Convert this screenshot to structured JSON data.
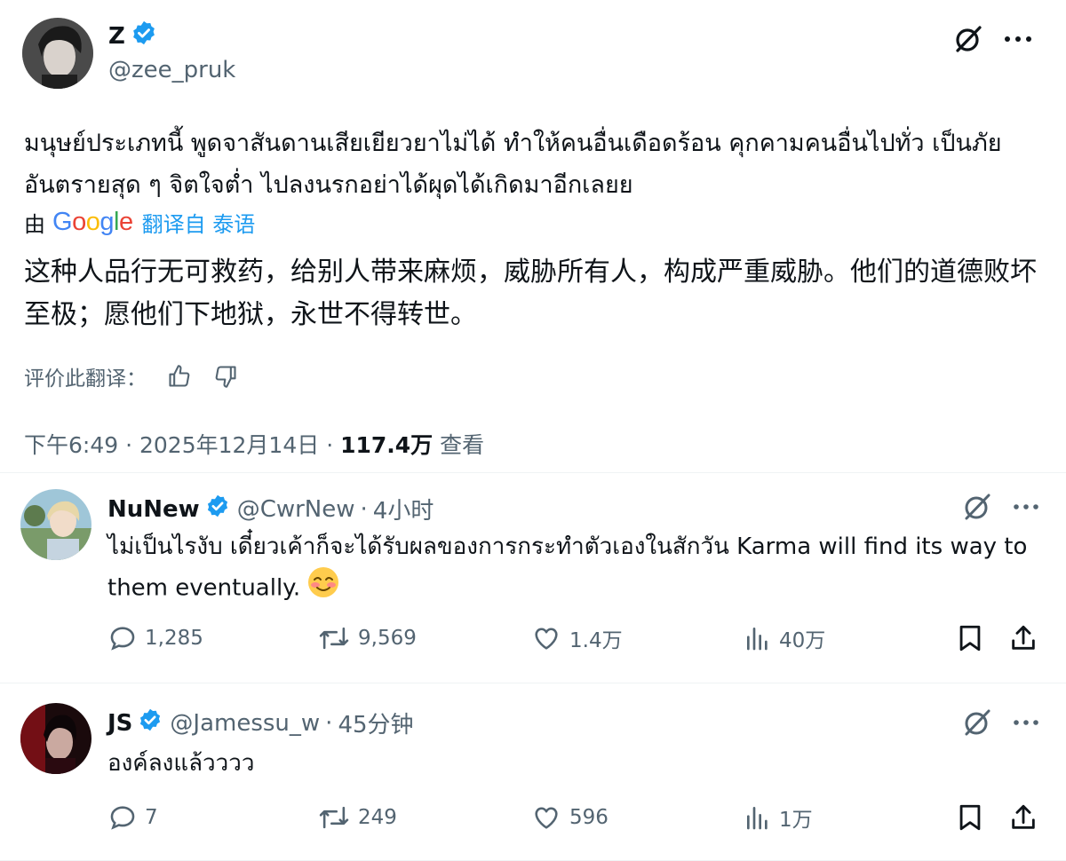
{
  "main_tweet": {
    "display_name": "Z",
    "handle": "@zee_pruk",
    "verified": true,
    "text_thai": "มนุษย์ประเภทนี้ พูดจาสันดานเสียเยียวยาไม่ได้ ทำให้คนอื่นเดือดร้อน คุกคามคนอื่นไปทั่ว เป็นภัยอันตรายสุด ๆ จิตใจต่ำ ไปลงนรกอย่าได้ผุดได้เกิดมาอีกเลยย",
    "translation": {
      "by_label": "由",
      "google": {
        "G": "G",
        "o1": "o",
        "o2": "o",
        "g": "g",
        "l": "l",
        "e": "e"
      },
      "link": "翻译自 泰语",
      "text": "这种人品行无可救药，给别人带来麻烦，威胁所有人，构成严重威胁。他们的道德败坏至极；愿他们下地狱，永世不得转世。",
      "rate_label": "评价此翻译："
    },
    "time": "下午6:49",
    "date": "2025年12月14日",
    "views_count": "117.4万",
    "views_label": "查看",
    "sep": "·"
  },
  "replies": [
    {
      "display_name": "NuNew",
      "handle": "@CwrNew",
      "time": "4小时",
      "sep": "·",
      "text": "ไม่เป็นไรงับ เดี๋ยวเค้าก็จะได้รับผลของการกระทำตัวเองในสักวัน Karma will find its way to them eventually.",
      "emoji": "smiling-face-with-blush",
      "stats": {
        "replies": "1,285",
        "reposts": "9,569",
        "likes": "1.4万",
        "views": "40万"
      }
    },
    {
      "display_name": "JS",
      "handle": "@Jamessu_w",
      "time": "45分钟",
      "sep": "·",
      "text": "องค์ลงแล้วววว",
      "stats": {
        "replies": "7",
        "reposts": "249",
        "likes": "596",
        "views": "1万"
      }
    }
  ],
  "colors": {
    "accent": "#1d9bf0",
    "muted": "#536471",
    "text": "#0f1419",
    "divider": "#eff3f4"
  }
}
